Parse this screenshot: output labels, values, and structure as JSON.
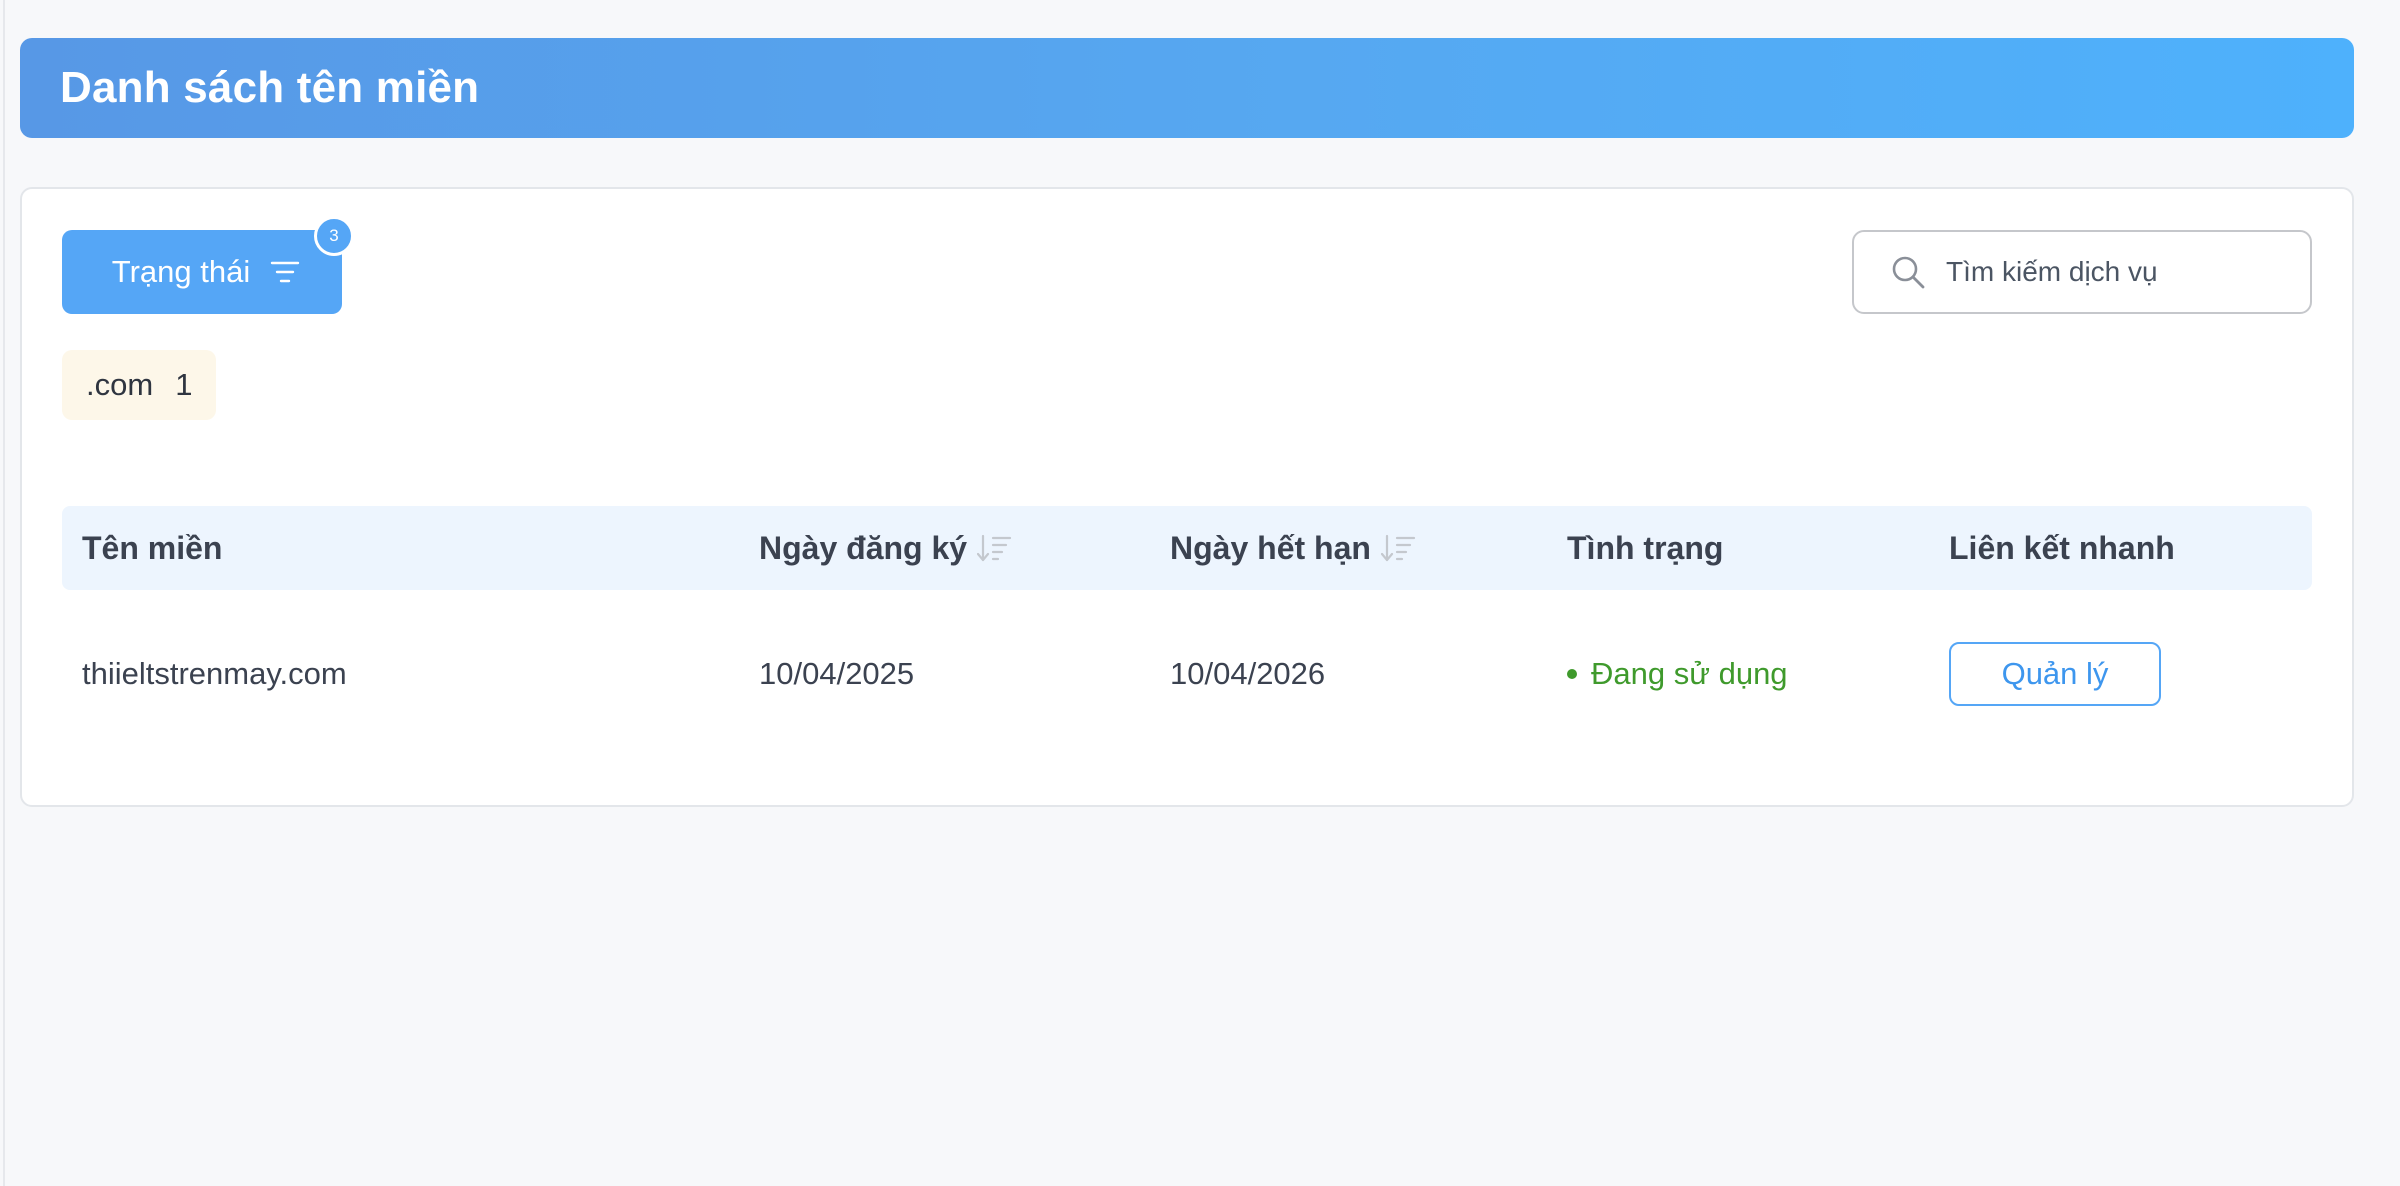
{
  "header": {
    "title": "Danh sách tên miền",
    "accent_from": "#5798e6",
    "accent_to": "#4eb1fc"
  },
  "toolbar": {
    "filter_label": "Trạng thái",
    "filter_icon": "filter-lines-icon",
    "filter_badge": "3",
    "search_placeholder": "Tìm kiếm dịch vụ",
    "search_value": "",
    "search_icon": "search-icon"
  },
  "tag_filter": {
    "label": ".com",
    "count": "1"
  },
  "table": {
    "columns": [
      {
        "label": "Tên miền",
        "sortable": false
      },
      {
        "label": "Ngày đăng ký",
        "sortable": true
      },
      {
        "label": "Ngày hết hạn",
        "sortable": true
      },
      {
        "label": "Tình trạng",
        "sortable": false
      },
      {
        "label": "Liên kết nhanh",
        "sortable": false
      }
    ],
    "rows": [
      {
        "domain": "thiieltstrenmay.com",
        "registered": "10/04/2025",
        "expires": "10/04/2026",
        "status": "Đang sử dụng",
        "status_color": "#3f9a2c",
        "action": "Quản lý"
      }
    ]
  }
}
